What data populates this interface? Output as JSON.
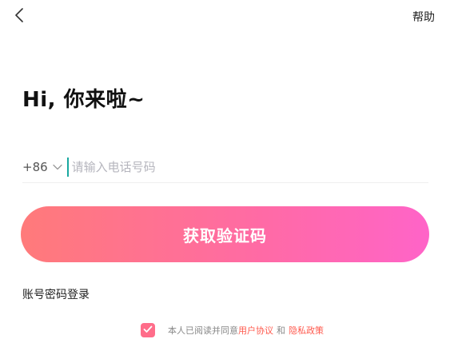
{
  "header": {
    "back_icon": "chevron-left-icon",
    "help_label": "帮助"
  },
  "greeting": "Hi, 你来啦~",
  "phone": {
    "country_code": "+86",
    "dropdown_icon": "chevron-down-icon",
    "placeholder": "请输入电话号码",
    "value": ""
  },
  "cta": {
    "label": "获取验证码"
  },
  "alt_login": {
    "label": "账号密码登录"
  },
  "agreement": {
    "checked": true,
    "prefix": "本人已阅读并同意",
    "user_agreement": "用户协议",
    "and": "和",
    "privacy_policy": "隐私政策"
  },
  "colors": {
    "gradient_start": "#ff7a7a",
    "gradient_end": "#ff64c8",
    "link": "#ff5a4e",
    "checkbox": "#ff6d8a",
    "caret": "#19a8a0"
  }
}
